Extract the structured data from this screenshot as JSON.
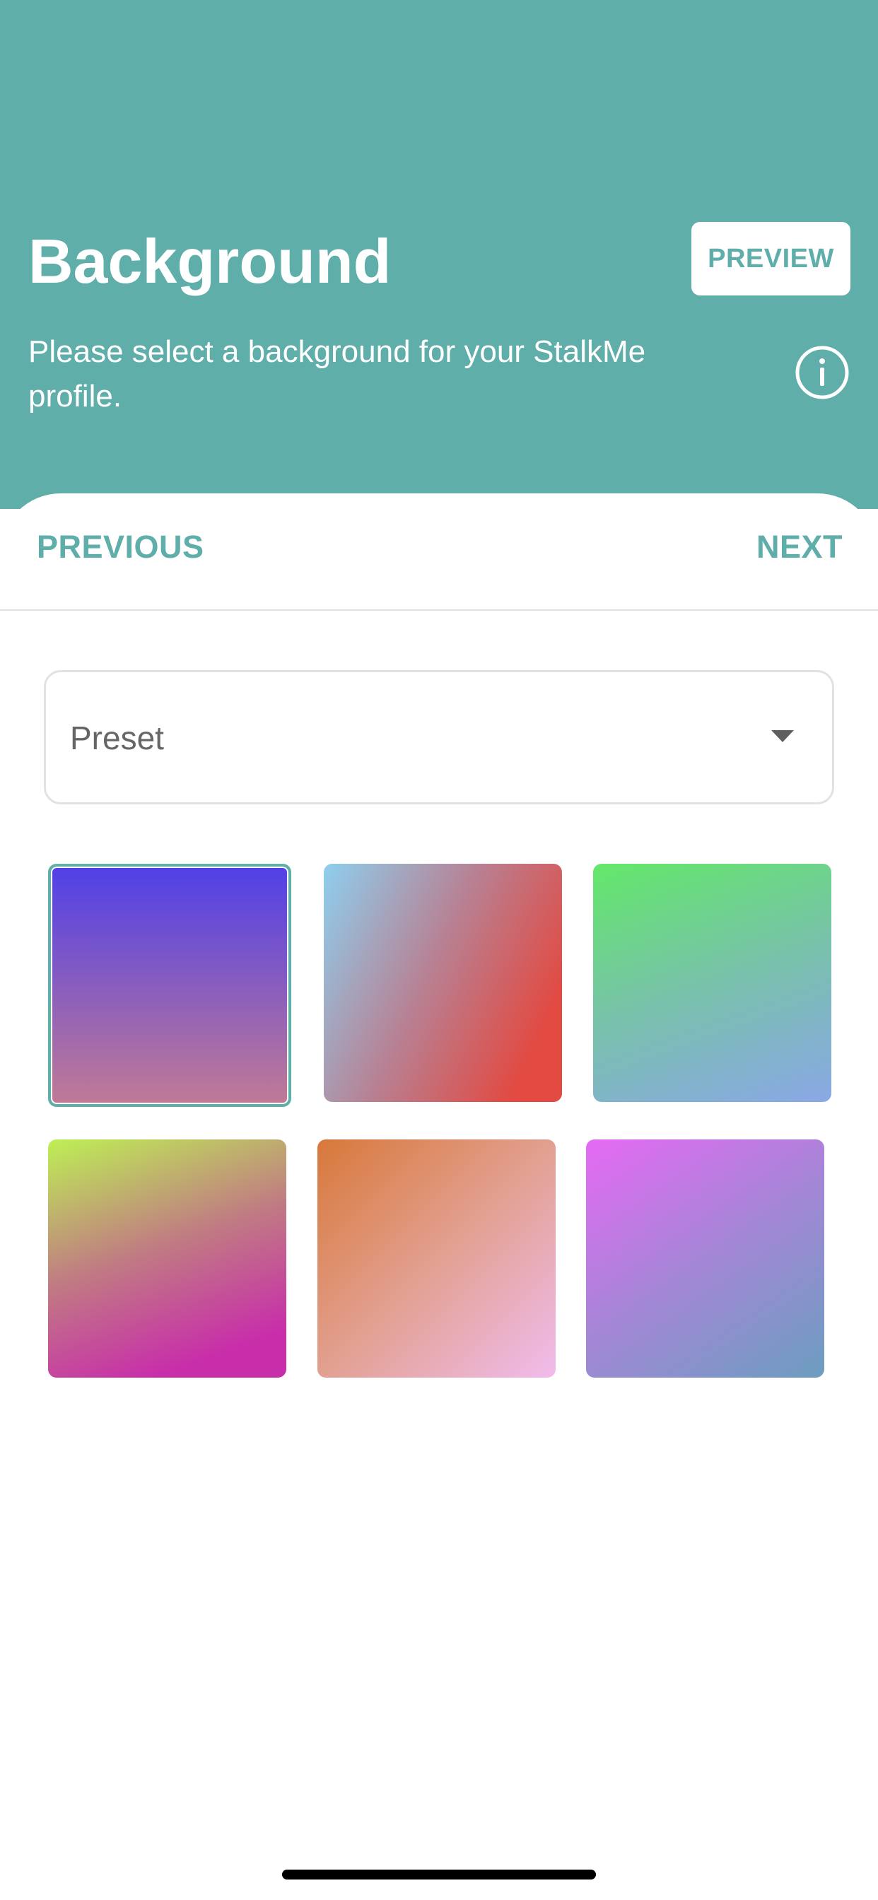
{
  "header": {
    "title": "Background",
    "preview_label": "PREVIEW",
    "subtitle": "Please select a background for your StalkMe profile.",
    "info_icon": "info-icon",
    "background_color": "#5faeaa"
  },
  "navigation": {
    "previous_label": "PREVIOUS",
    "next_label": "NEXT"
  },
  "dropdown": {
    "selected_value": "Preset",
    "icon": "chevron-down-icon"
  },
  "swatches": [
    {
      "name": "purple-mauve",
      "colors": [
        "#5040e8",
        "#c07a96"
      ],
      "selected": true
    },
    {
      "name": "skyblue-red",
      "colors": [
        "#8ecfee",
        "#e24a42"
      ],
      "selected": false
    },
    {
      "name": "green-blue",
      "colors": [
        "#63e86a",
        "#8aa8e6"
      ],
      "selected": false
    },
    {
      "name": "lime-magenta",
      "colors": [
        "#bef054",
        "#c82eaa"
      ],
      "selected": false
    },
    {
      "name": "orange-pink",
      "colors": [
        "#d8783a",
        "#f0bcec"
      ],
      "selected": false
    },
    {
      "name": "violet-steelblue",
      "colors": [
        "#e66af4",
        "#6c9ec0"
      ],
      "selected": false
    }
  ]
}
